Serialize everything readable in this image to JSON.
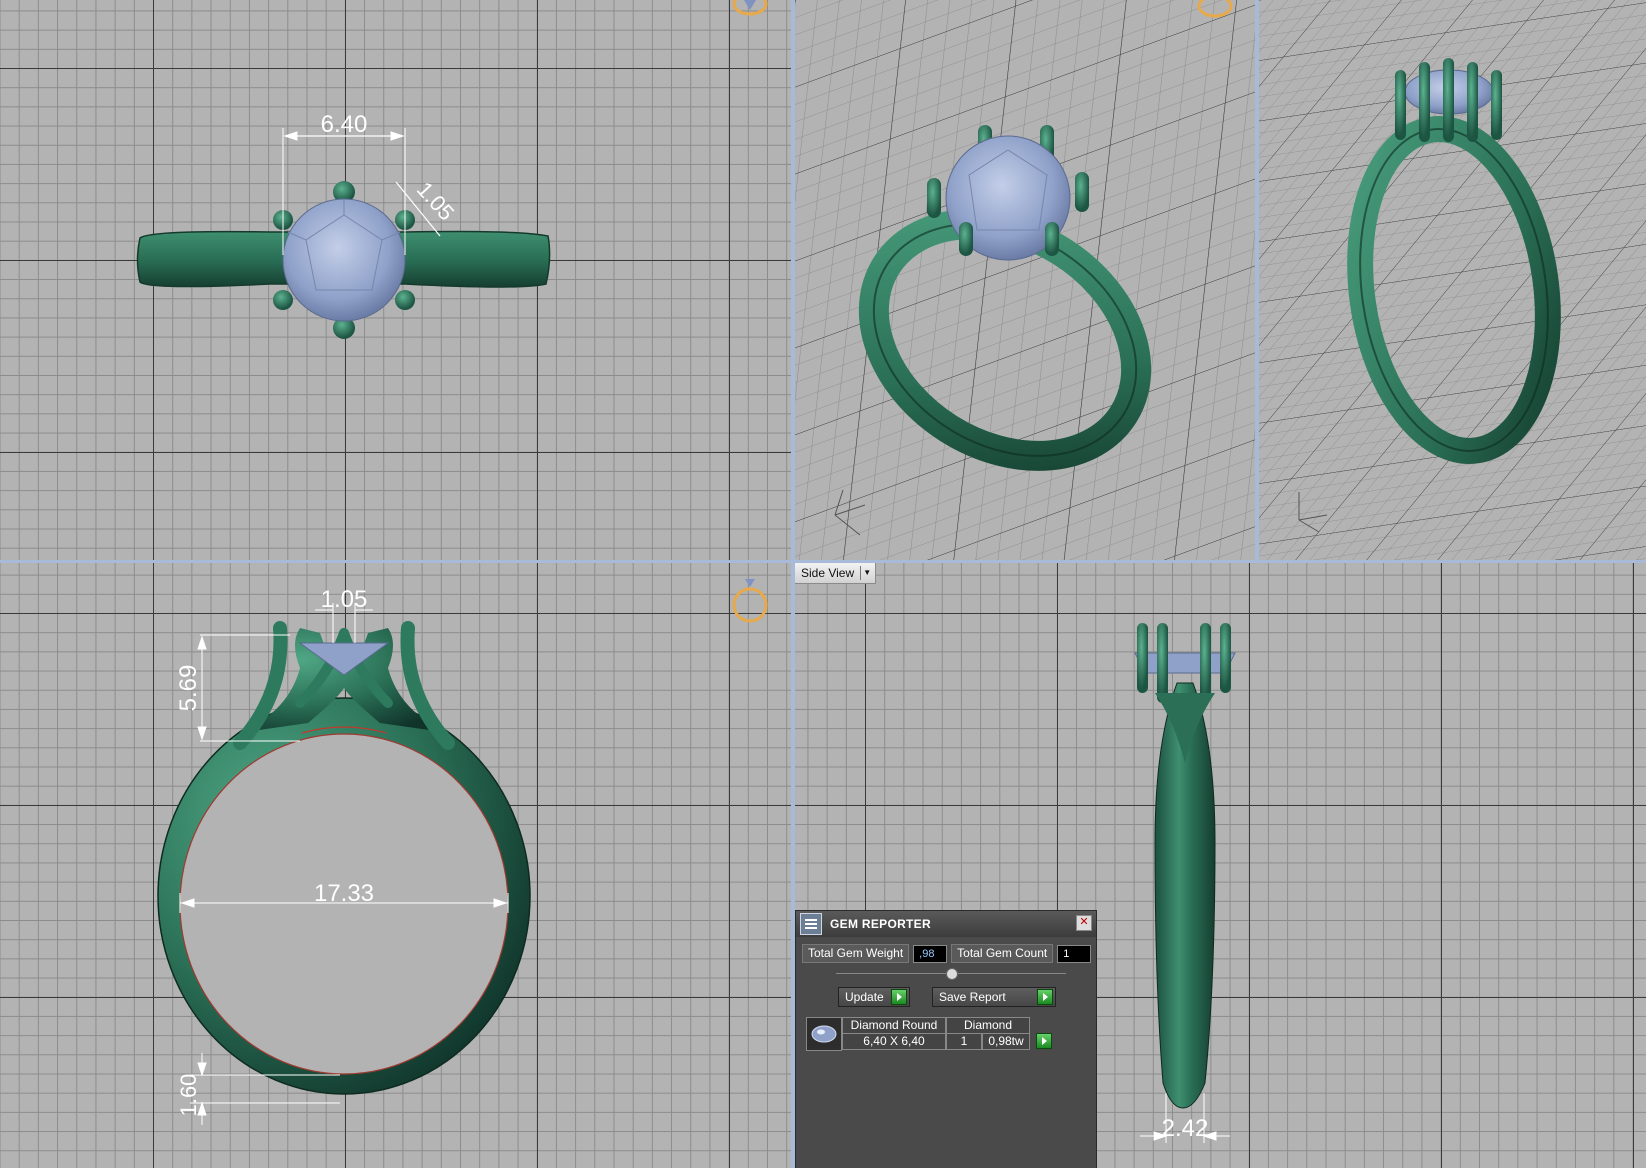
{
  "viewports": {
    "top": {
      "dims": {
        "width": "6.40",
        "prong": "1.05"
      }
    },
    "front": {
      "dims": {
        "prong": "1.05",
        "height": "5.69",
        "inner": "17.33",
        "band": "1.60"
      }
    },
    "side": {
      "tab_label": "Side View",
      "dims": {
        "width": "2.42"
      }
    }
  },
  "gem_reporter": {
    "title": "GEM REPORTER",
    "total_weight_label": "Total Gem Weight",
    "total_weight_value": ",98",
    "total_count_label": "Total Gem Count",
    "total_count_value": "1",
    "update_label": "Update",
    "save_label": "Save Report",
    "row": {
      "shape": "Diamond Round",
      "material": "Diamond",
      "size": "6,40 X 6,40",
      "count": "1",
      "weight": "0,98tw"
    }
  },
  "colors": {
    "metal": "#2d7a5f",
    "metal_dark": "#1b4f3c",
    "gem": "#9fb0d6",
    "grid": "#b3b3b3",
    "dimension": "#ffffff"
  },
  "icons": [
    "ring-top-icon",
    "ring-front-icon",
    "axis-tripod-icon",
    "gem-reporter-icon",
    "close-icon",
    "go-arrow-icon"
  ]
}
